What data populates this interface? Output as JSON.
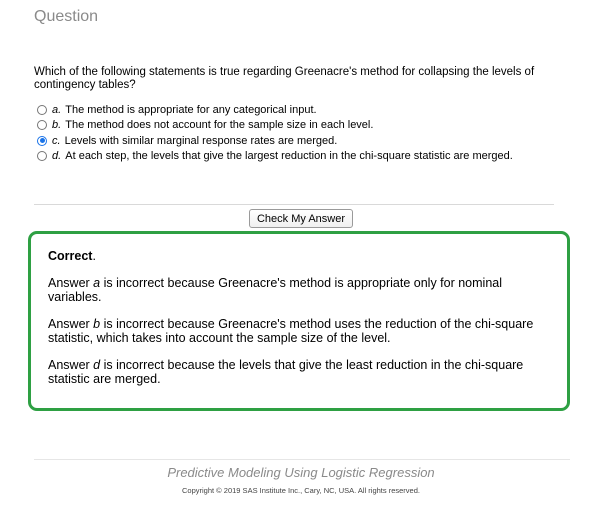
{
  "header": {
    "title": "Question"
  },
  "question": {
    "text": "Which of the following statements is true regarding Greenacre's method for collapsing the levels of contingency tables?",
    "options": [
      {
        "letter": "a.",
        "text": "The method is appropriate for any categorical input.",
        "selected": false
      },
      {
        "letter": "b.",
        "text": "The method does not account for the sample size in each level.",
        "selected": false
      },
      {
        "letter": "c.",
        "text": "Levels with similar marginal response rates are merged.",
        "selected": true
      },
      {
        "letter": "d.",
        "text": "At each step, the levels that give the largest reduction in the chi-square statistic are merged.",
        "selected": false
      }
    ]
  },
  "actions": {
    "check_label": "Check My Answer"
  },
  "feedback": {
    "title": "Correct",
    "title_suffix": ".",
    "border_color": "#2ea043",
    "paragraphs": [
      {
        "prefix": "Answer ",
        "letter": "a",
        "rest": " is incorrect because Greenacre's method is appropriate only for nominal variables."
      },
      {
        "prefix": "Answer ",
        "letter": "b",
        "rest": " is incorrect because Greenacre's method uses the reduction of the chi-square statistic, which takes into account the sample size of the level."
      },
      {
        "prefix": "Answer ",
        "letter": "d",
        "rest": " is incorrect because the levels that give the least reduction in the chi-square statistic are merged."
      }
    ]
  },
  "footer": {
    "course_title": "Predictive Modeling Using Logistic Regression",
    "copyright": "Copyright © 2019 SAS Institute Inc., Cary, NC, USA. All rights reserved."
  },
  "colors": {
    "accent": "#1a73e8",
    "correct": "#2ea043",
    "muted": "#8a8a8a"
  }
}
